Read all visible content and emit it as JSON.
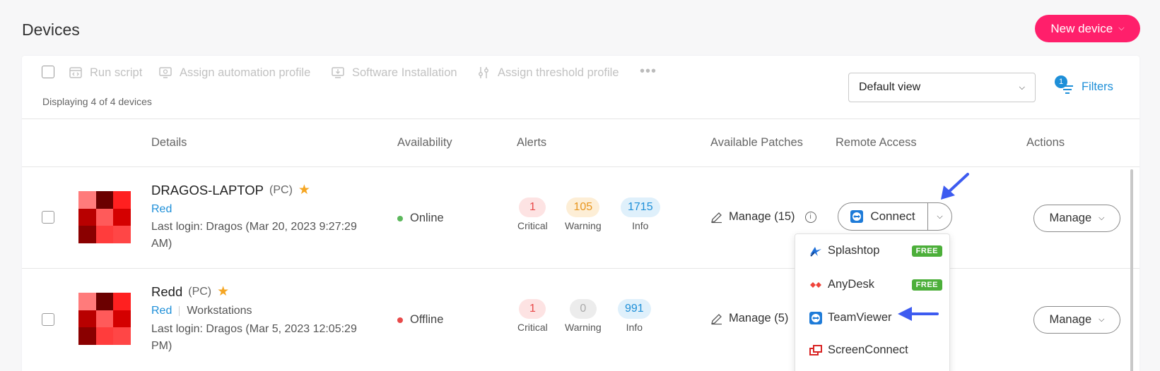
{
  "page": {
    "title": "Devices"
  },
  "header": {
    "new_device_label": "New device"
  },
  "toolbar": {
    "run_script": "Run script",
    "assign_automation": "Assign automation profile",
    "software_installation": "Software Installation",
    "assign_threshold": "Assign threshold profile",
    "more": "•••",
    "display_count": "Displaying 4 of 4 devices",
    "view_select": "Default view",
    "filters_label": "Filters",
    "filters_count": "1"
  },
  "columns": {
    "details": "Details",
    "availability": "Availability",
    "alerts": "Alerts",
    "available_patches": "Available Patches",
    "remote_access": "Remote Access",
    "actions": "Actions"
  },
  "alert_labels": {
    "critical": "Critical",
    "warning": "Warning",
    "info": "Info"
  },
  "devices": [
    {
      "name": "DRAGOS-LAPTOP",
      "type": "(PC)",
      "group": "Red",
      "category": "",
      "last_login": "Last login: Dragos (Mar 20, 2023 9:27:29 AM)",
      "availability": "Online",
      "critical": "1",
      "warning": "105",
      "info": "1715",
      "patches": "Manage  (15)",
      "manage_label": "Manage"
    },
    {
      "name": "Redd",
      "type": "(PC)",
      "group": "Red",
      "category": "Workstations",
      "last_login": "Last login: Dragos (Mar 5, 2023 12:05:29 PM)",
      "availability": "Offline",
      "critical": "1",
      "warning": "0",
      "info": "991",
      "patches": "Manage  (5)",
      "manage_label": "Manage"
    }
  ],
  "remote": {
    "connect_label": "Connect",
    "options": [
      {
        "label": "Splashtop",
        "badge": "FREE"
      },
      {
        "label": "AnyDesk",
        "badge": "FREE"
      },
      {
        "label": "TeamViewer",
        "badge": ""
      },
      {
        "label": "ScreenConnect",
        "badge": ""
      }
    ]
  },
  "colors": {
    "accent": "#ff1f6b",
    "link": "#1e8fd8",
    "online": "#5cb85c",
    "offline": "#e84a4a",
    "free_badge": "#4caf3a",
    "annotation_arrow": "#3d5bf0"
  }
}
